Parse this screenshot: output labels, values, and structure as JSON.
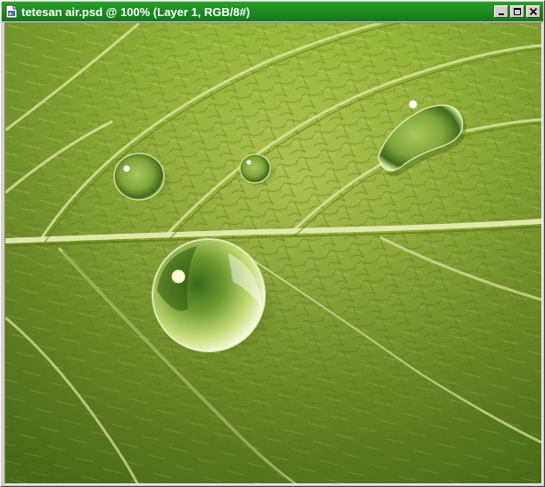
{
  "window": {
    "title": "tetesan air.psd @ 100% (Layer 1, RGB/8#)"
  },
  "icons": {
    "document": "document-icon",
    "minimize": "minimize-icon",
    "maximize": "maximize-icon",
    "close": "close-icon"
  },
  "colors": {
    "titlebar": "#1b8a1b",
    "leaf_light": "#b7cf4e",
    "leaf_dark": "#4e7015"
  }
}
